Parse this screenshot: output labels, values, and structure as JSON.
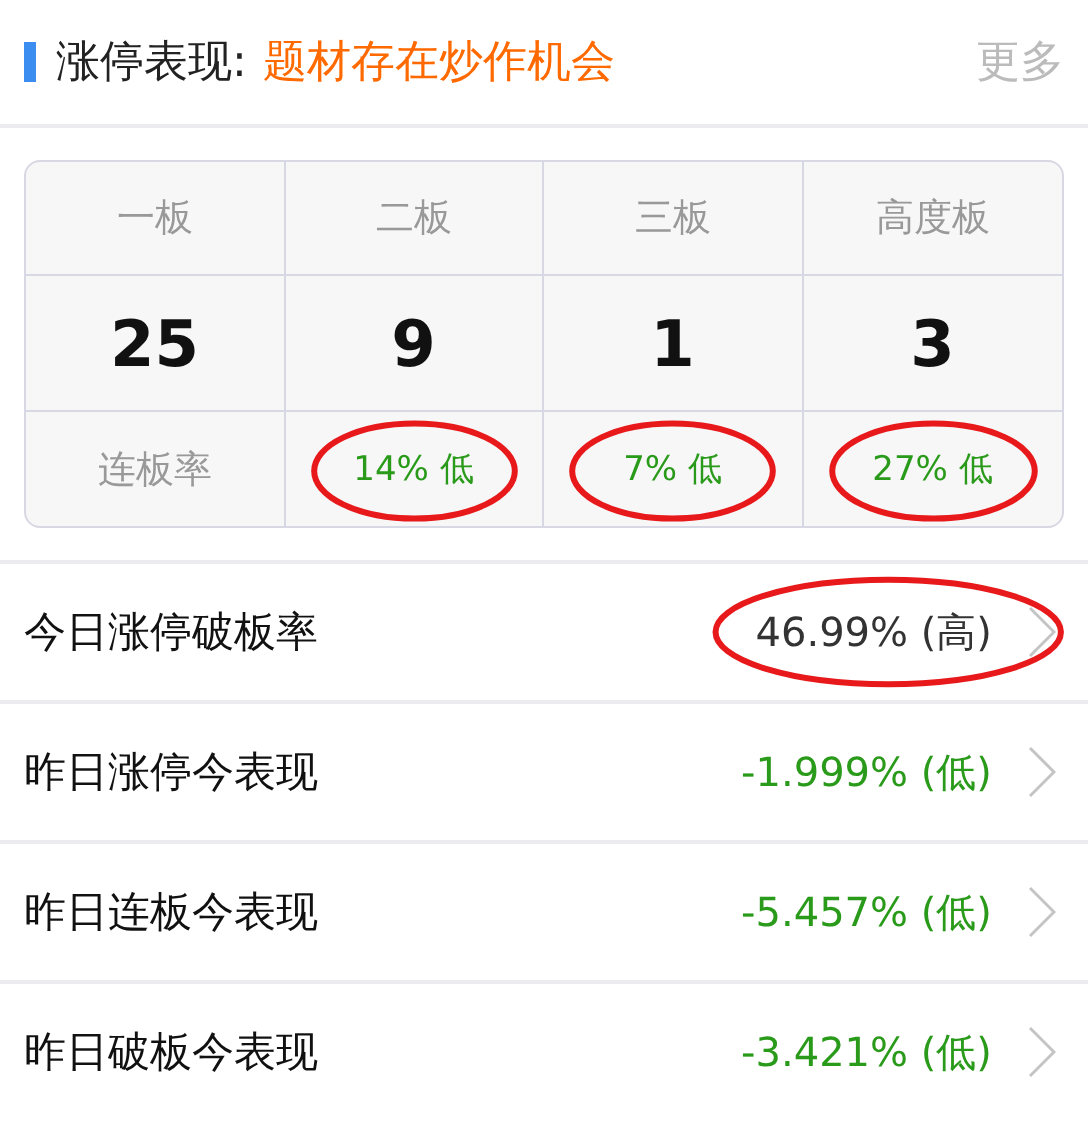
{
  "header": {
    "label": "涨停表现:",
    "theme": "题材存在炒作机会",
    "more": "更多"
  },
  "board_table": {
    "columns": [
      {
        "heading": "一板",
        "count": "25"
      },
      {
        "heading": "二板",
        "count": "9"
      },
      {
        "heading": "三板",
        "count": "1"
      },
      {
        "heading": "高度板",
        "count": "3"
      }
    ],
    "rate_label": "连板率",
    "rates": [
      {
        "text": "14% 低",
        "circled": true
      },
      {
        "text": "7% 低",
        "circled": true
      },
      {
        "text": "27% 低",
        "circled": true
      }
    ]
  },
  "rows": [
    {
      "label": "今日涨停破板率",
      "value": "46.99% (高)",
      "kind": "neutral",
      "circled": true
    },
    {
      "label": "昨日涨停今表现",
      "value": "-1.999% (低)",
      "kind": "down",
      "circled": false
    },
    {
      "label": "昨日连板今表现",
      "value": "-5.457% (低)",
      "kind": "down",
      "circled": false
    },
    {
      "label": "昨日破板今表现",
      "value": "-3.421% (低)",
      "kind": "down",
      "circled": false
    }
  ]
}
